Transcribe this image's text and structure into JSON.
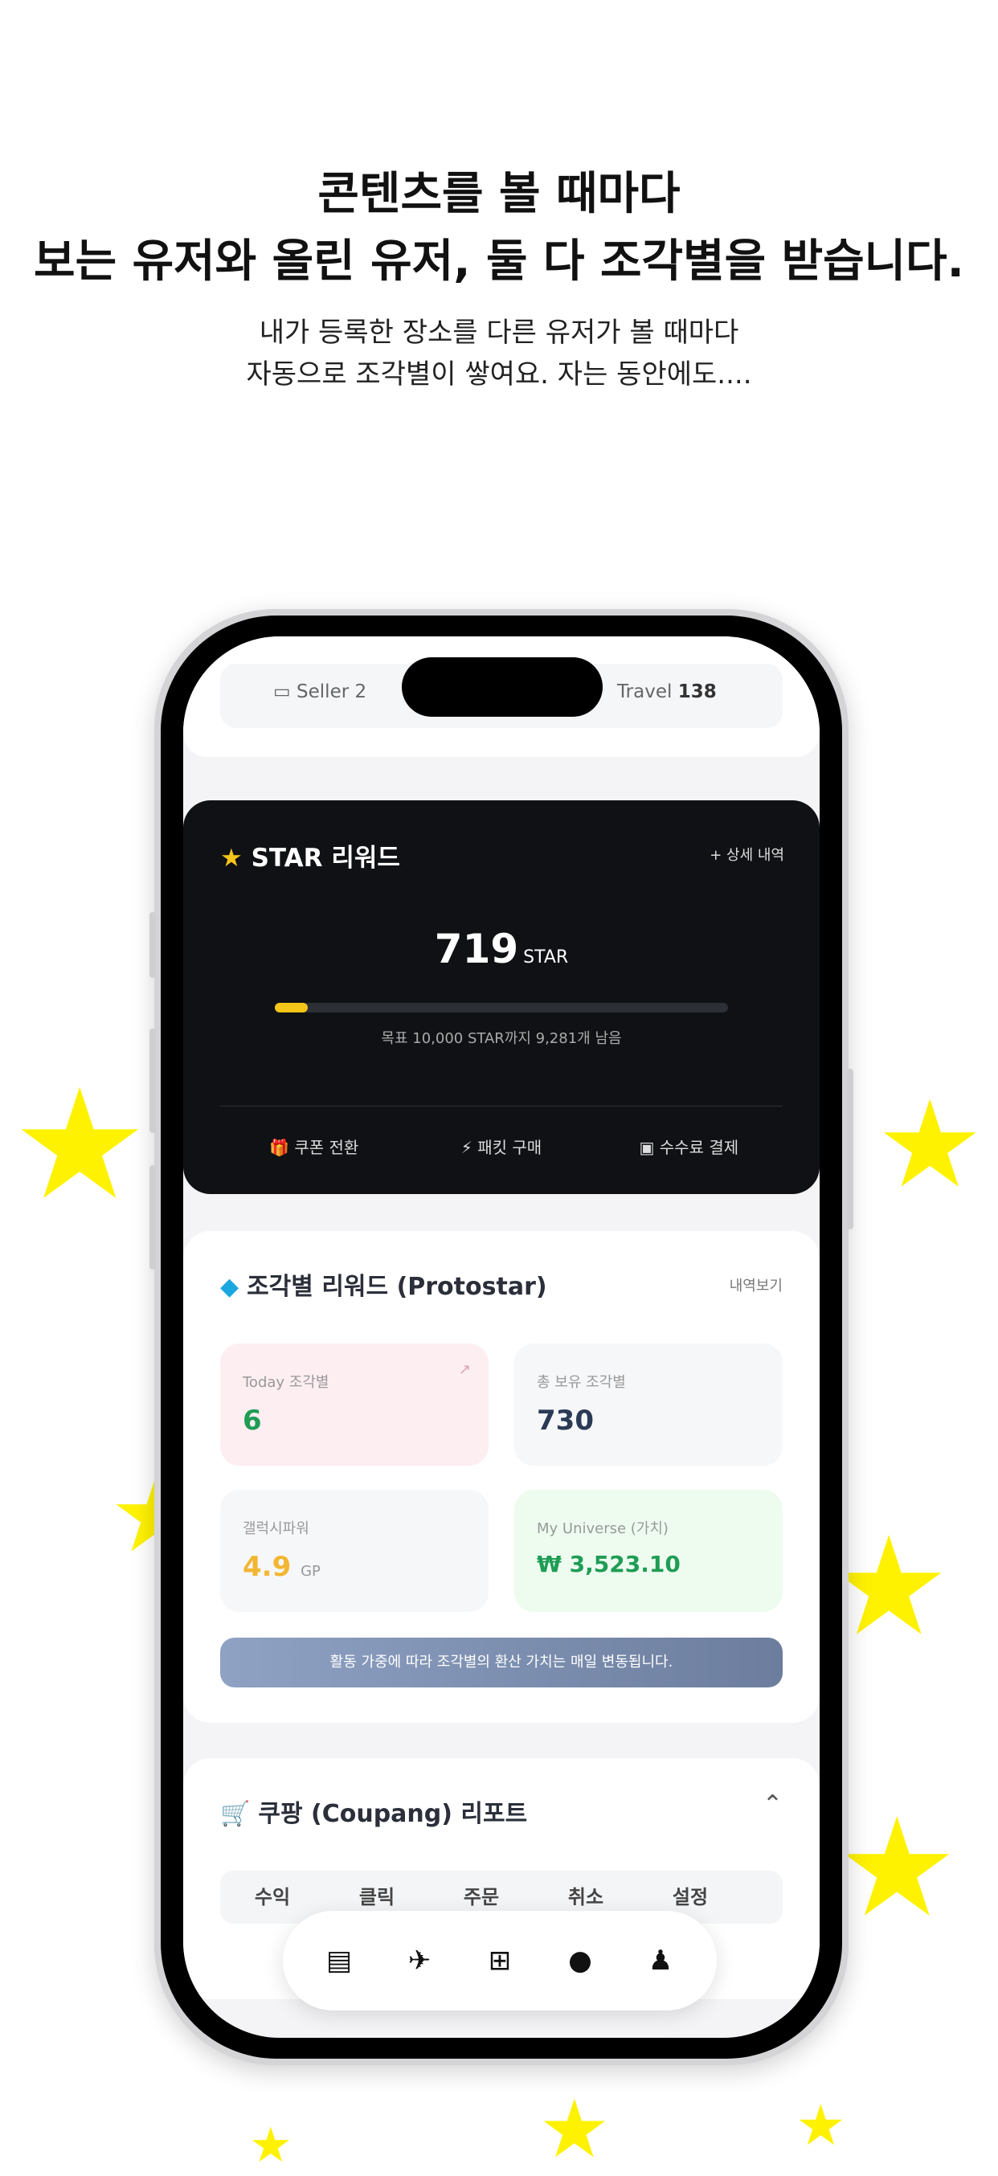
{
  "headline": {
    "line1": "콘텐츠를 볼 때마다",
    "line2": "보는 유저와 올린 유저, 둘 다 조각별을 받습니다.",
    "sub1": "내가 등록한 장소를 다른 유저가 볼 때마다",
    "sub2": "자동으로 조각별이 쌓여요. 자는 동안에도...."
  },
  "top_tabs": {
    "seller_icon": "store-icon",
    "seller_label": "Seller 2",
    "travel_label": "Travel",
    "travel_count": "138"
  },
  "star_card": {
    "icon": "star-icon",
    "title": "STAR 리워드",
    "detail_link": "+ 상세 내역",
    "value": "719",
    "unit": "STAR",
    "progress_fraction": 0.0719,
    "goal_text": "목표 10,000 STAR까지 9,281개 남음",
    "actions": [
      {
        "icon": "gift-icon",
        "label": "쿠폰 전환"
      },
      {
        "icon": "bolt-icon",
        "label": "패킷 구매"
      },
      {
        "icon": "card-icon",
        "label": "수수료 결제"
      }
    ]
  },
  "proto_card": {
    "icon": "gem-icon",
    "title": "조각별 리워드 (Protostar)",
    "more_link": "내역보기",
    "tiles": {
      "today": {
        "label": "Today 조각별",
        "value": "6",
        "color": "#1f9d55"
      },
      "total": {
        "label": "총 보유 조각별",
        "value": "730",
        "color": "#2b3a55"
      },
      "galaxy": {
        "label": "갤럭시파워",
        "value": "4.9",
        "unit": "GP",
        "color": "#f2b632"
      },
      "universe": {
        "label": "My Universe (가치)",
        "value": "₩ 3,523.10",
        "color": "#1f9d55"
      }
    },
    "notice": "활동 가중에 따라 조각별의 환산 가치는 매일 변동됩니다."
  },
  "coupang_card": {
    "icon": "cart-icon",
    "title": "쿠팡 (Coupang) 리포트",
    "columns": [
      "수익",
      "클릭",
      "주문",
      "취소",
      "설정"
    ]
  },
  "bottom_nav": [
    {
      "icon": "store-icon"
    },
    {
      "icon": "airplane-icon"
    },
    {
      "icon": "plus-square-icon"
    },
    {
      "icon": "chat-icon"
    },
    {
      "icon": "user-icon"
    }
  ],
  "colors": {
    "star_yellow": "#fff200",
    "progress_fill": "#f5c518",
    "today_tile_bg": "#fdeef2",
    "universe_tile_bg": "#eefcf0"
  }
}
